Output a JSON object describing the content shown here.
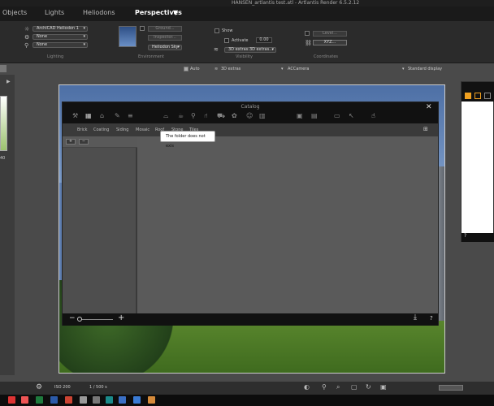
{
  "window": {
    "title": "HANSEN_artlantis test.atl - Artlantis Render 6.5.2.12"
  },
  "tabs": [
    {
      "label": "Objects"
    },
    {
      "label": "Lights"
    },
    {
      "label": "Heliodons"
    },
    {
      "label": "Perspectives"
    }
  ],
  "tab_dropdown_icon": "▼",
  "toolbar": {
    "heliodon_select": "ArchiCAD Heliodon 1",
    "none_select_1": "None",
    "none_select_2": "None",
    "lighting_label": "Lighting",
    "ground_button": "Ground...",
    "inspector_button": "Inspector...",
    "sky_select": "Heliodon Sky",
    "environment_label": "Environment",
    "show_label": "Show",
    "activate_label": "Activate",
    "activate_value": "0.00",
    "visibility_select": "3D extras:3D extras...",
    "visibility_label": "Visibility",
    "level_button": "Level...",
    "xyz_button": "XYZ...",
    "coordinates_label": "Coordinates"
  },
  "bar2": {
    "auto_label": "Auto",
    "extras_label": "3D extras",
    "camera_label": "ACCamera",
    "display_label": "Standard display"
  },
  "left_strip": {
    "number": "40"
  },
  "catalog": {
    "title": "Catalog",
    "close": "✕",
    "tabs": [
      "Brick",
      "Coating",
      "Siding",
      "Mosaic",
      "Roof",
      "Stone",
      "Tiles"
    ],
    "left_buttons": [
      "+",
      "−"
    ],
    "footer_minus": "−",
    "footer_plus": "+",
    "footer_download": "⤓",
    "footer_help": "?"
  },
  "tooltip": {
    "text": "The folder does not exis"
  },
  "right_panel": {
    "help": "?"
  },
  "status": {
    "iso": "ISO 200",
    "speed": "1 / 500 s"
  },
  "icons": {
    "gear": "gear-icon",
    "search": "search-icon",
    "folder": "folder-icon",
    "hand": "hand-icon"
  }
}
